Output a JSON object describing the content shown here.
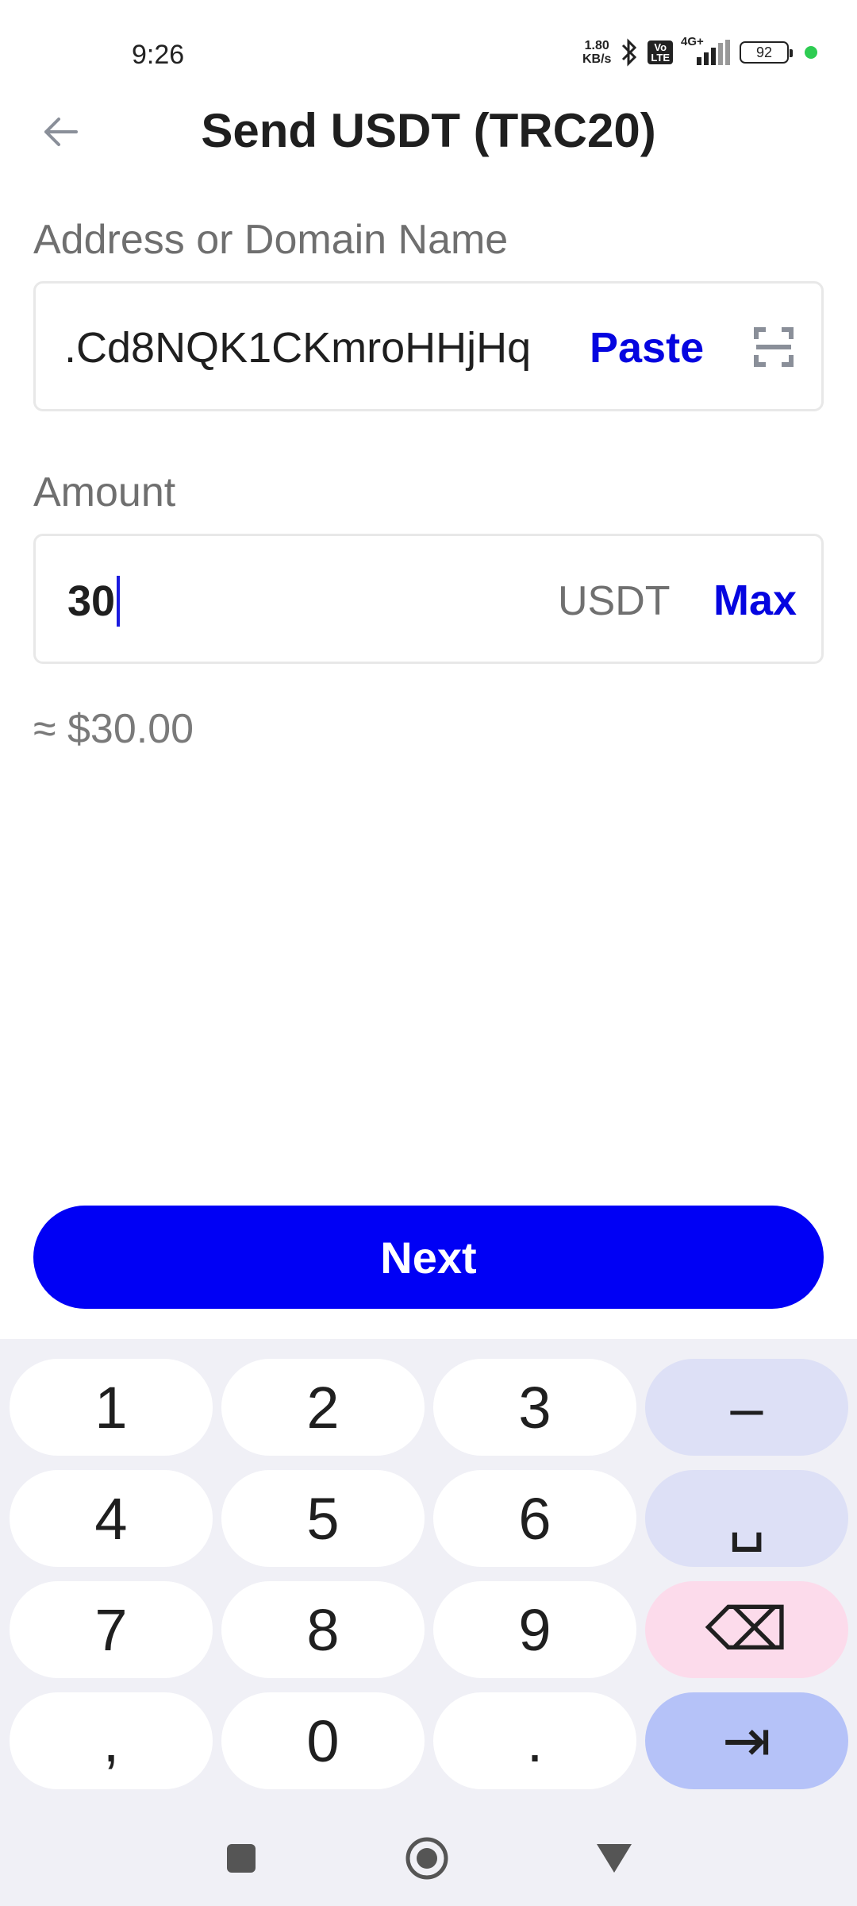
{
  "status_bar": {
    "time": "9:26",
    "net_speed_value": "1.80",
    "net_speed_unit": "KB/s",
    "volte_top": "Vo",
    "volte_bottom": "LTE",
    "network_type": "4G+",
    "battery": "92",
    "icons": [
      "bluetooth-icon",
      "signal-icon",
      "battery-icon"
    ]
  },
  "header": {
    "title": "Send USDT (TRC20)",
    "back_icon": "arrow-left-icon"
  },
  "address": {
    "label": "Address or Domain Name",
    "value": ".Cd8NQK1CKmroHHjHq",
    "paste_label": "Paste",
    "scan_icon": "scan-icon"
  },
  "amount": {
    "label": "Amount",
    "value": "30",
    "unit": "USDT",
    "max_label": "Max",
    "fiat_estimate": "≈ $30.00"
  },
  "next_button": {
    "label": "Next"
  },
  "keyboard": {
    "rows": [
      [
        "1",
        "2",
        "3",
        "–"
      ],
      [
        "4",
        "5",
        "6",
        "␣"
      ],
      [
        "7",
        "8",
        "9",
        "⌫"
      ],
      [
        ",",
        "0",
        ".",
        "⇥"
      ]
    ]
  },
  "colors": {
    "accent": "#0000f5",
    "link": "#0505e0",
    "keyboard_bg": "#f0f0f6",
    "key_delete": "#fcdbeb",
    "key_enter": "#b5c2f8"
  }
}
